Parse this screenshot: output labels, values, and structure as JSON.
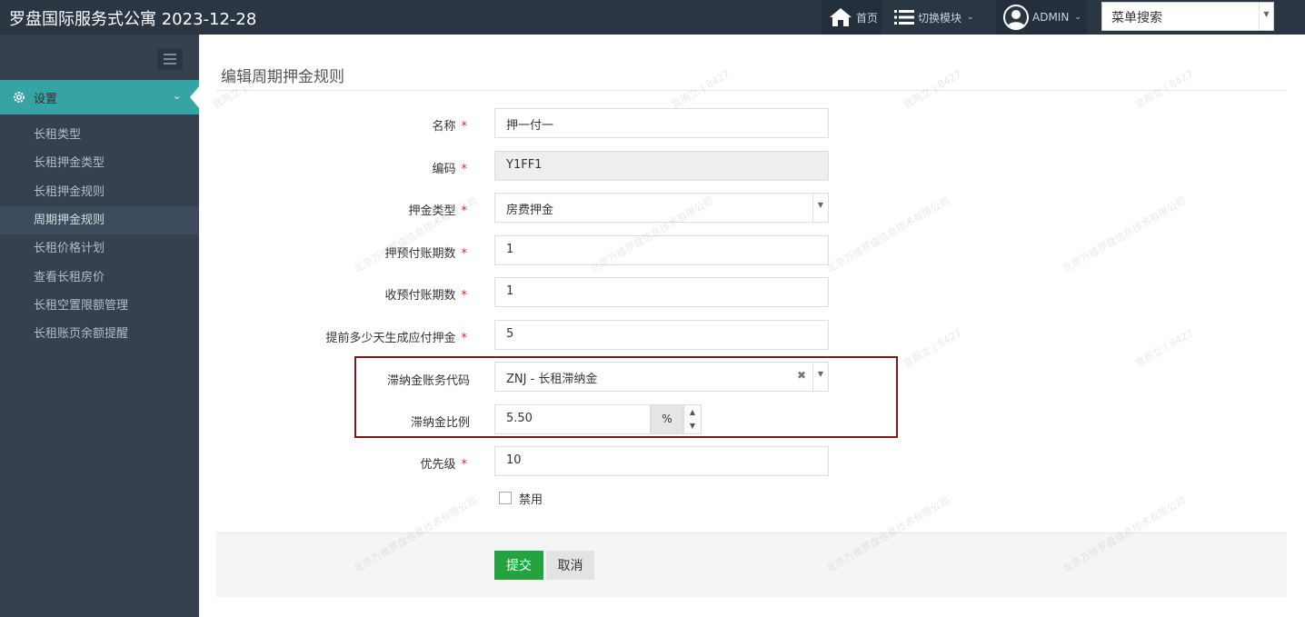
{
  "app": {
    "title": "罗盘国际服务式公寓 2023-12-28"
  },
  "topnav": {
    "home_label": "首页",
    "switch_label": "切换模块",
    "user_label": "ADMIN",
    "menu_search_value": "菜单搜索"
  },
  "sidebar": {
    "section_label": "设置",
    "items": [
      {
        "label": "长租类型"
      },
      {
        "label": "长租押金类型"
      },
      {
        "label": "长租押金规则"
      },
      {
        "label": "周期押金规则"
      },
      {
        "label": "长租价格计划"
      },
      {
        "label": "查看长租房价"
      },
      {
        "label": "长租空置限额管理"
      },
      {
        "label": "长租账页余额提醒"
      }
    ],
    "current_index": 3
  },
  "page": {
    "title": "编辑周期押金规则"
  },
  "form": {
    "required_mark": "*",
    "name": {
      "label": "名称",
      "value": "押一付一"
    },
    "code": {
      "label": "编码",
      "value": "Y1FF1"
    },
    "deposit_type": {
      "label": "押金类型",
      "value": "房费押金"
    },
    "deposit_periods": {
      "label": "押预付账期数",
      "value": "1"
    },
    "prepay_periods": {
      "label": "收预付账期数",
      "value": "1"
    },
    "advance_days": {
      "label": "提前多少天生成应付押金",
      "value": "5"
    },
    "late_fee_code": {
      "label": "滞纳金账务代码",
      "value": "ZNJ - 长租滞纳金"
    },
    "late_fee_ratio": {
      "label": "滞纳金比例",
      "value": "5.50",
      "unit": "%"
    },
    "priority": {
      "label": "优先级",
      "value": "10"
    },
    "disabled": {
      "label": "禁用",
      "checked": false
    }
  },
  "actions": {
    "submit_label": "提交",
    "cancel_label": "取消"
  },
  "watermark": {
    "text_a": "北京万维罗盘信息技术有限公司",
    "text_b": "宫雨立 | 8427"
  },
  "colors": {
    "topbar": "#2b3643",
    "sidebar": "#364150",
    "active": "#36a3a5",
    "submit": "#26a341",
    "highlight": "#7b1a1a"
  }
}
